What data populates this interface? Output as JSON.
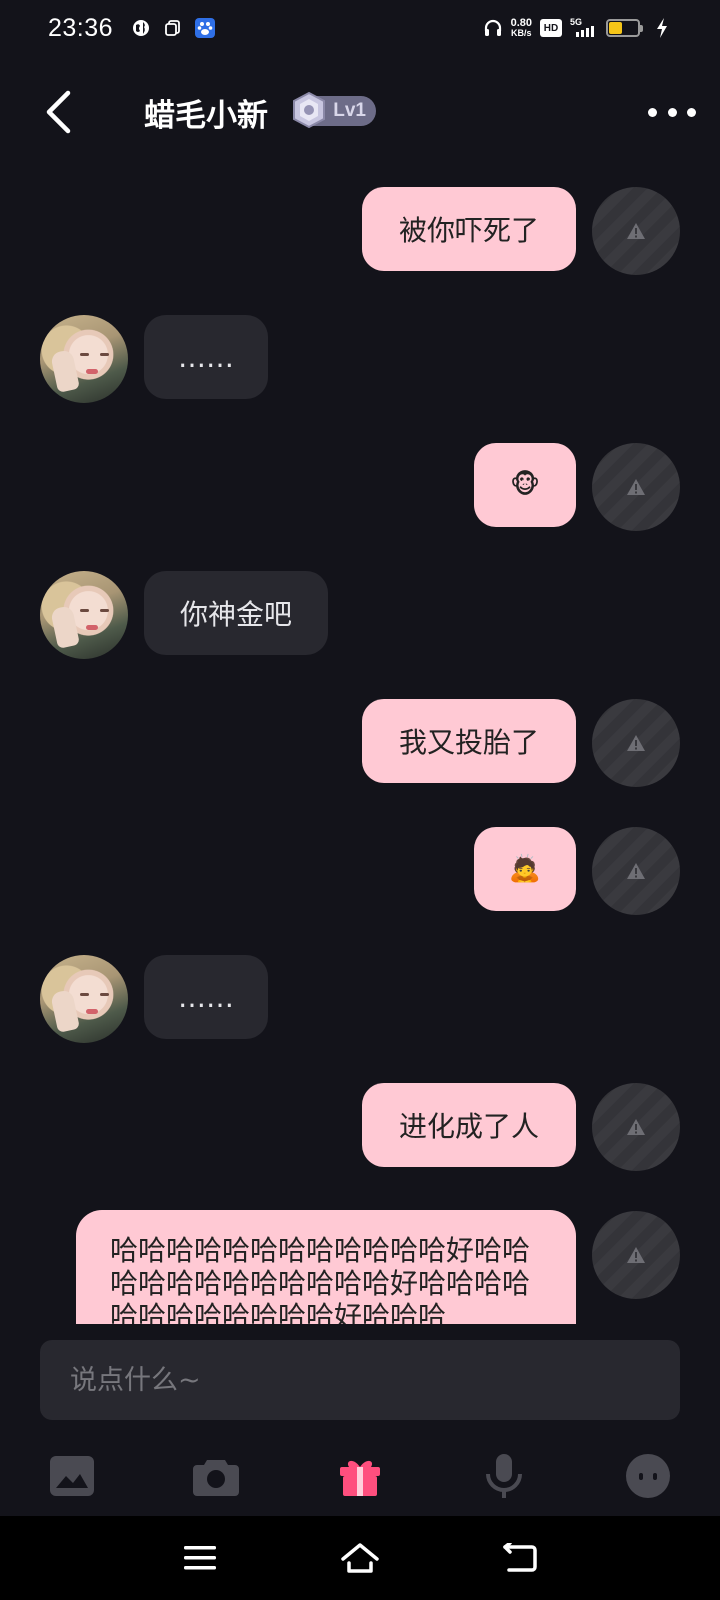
{
  "status_bar": {
    "time": "23:36",
    "net_speed_value": "0.80",
    "net_speed_unit": "KB/s",
    "hd_label": "HD",
    "network_label": "5G",
    "battery_level": 0.45,
    "icons": [
      "globe-icon",
      "copy-icon",
      "paw-app-icon",
      "headphones-icon",
      "charging-icon"
    ]
  },
  "header": {
    "title": "蜡毛小新",
    "level": "Lv1"
  },
  "messages": [
    {
      "side": "out",
      "text": "被你吓死了",
      "status": "failed"
    },
    {
      "side": "in",
      "text": "……"
    },
    {
      "side": "out",
      "text": "🐵",
      "status": "failed"
    },
    {
      "side": "in",
      "text": "你神金吧"
    },
    {
      "side": "out",
      "text": "我又投胎了",
      "status": "failed"
    },
    {
      "side": "out",
      "text": "🙇",
      "status": "failed"
    },
    {
      "side": "in",
      "text": "……"
    },
    {
      "side": "out",
      "text": "进化成了人",
      "status": "failed"
    },
    {
      "side": "out",
      "text": "哈哈哈哈哈哈哈哈哈哈哈哈好哈哈哈哈哈哈哈哈哈哈哈哈好哈哈哈哈哈哈哈哈哈哈哈哈好哈哈哈",
      "status": "failed"
    }
  ],
  "composer": {
    "placeholder": "说点什么~"
  },
  "toolbar": {
    "items": [
      "image-icon",
      "camera-icon",
      "gift-icon",
      "microphone-icon",
      "emoji-icon"
    ],
    "accent_color": "#ff4f7e"
  },
  "colors": {
    "background": "#13131a",
    "outgoing_bubble": "#ffc9d4",
    "incoming_bubble": "#28282f"
  }
}
